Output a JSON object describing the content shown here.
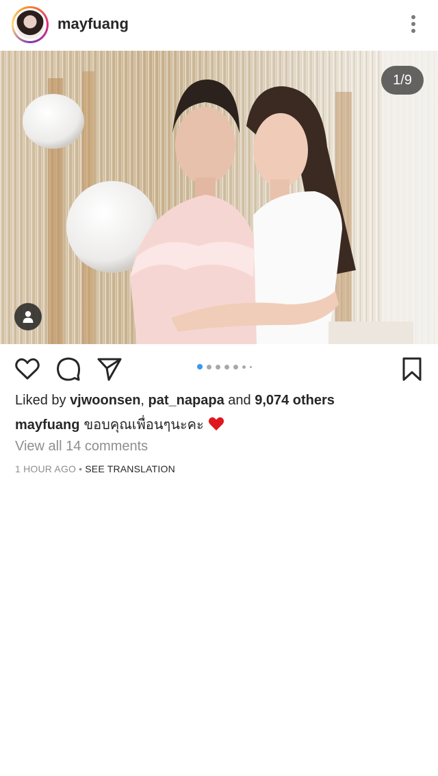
{
  "header": {
    "username": "mayfuang"
  },
  "photo": {
    "counter": "1/9",
    "icons": {
      "tag": "person-tag-icon"
    }
  },
  "actions": {
    "icons": [
      "heart-icon",
      "comment-icon",
      "share-icon",
      "bookmark-icon"
    ],
    "carousel_dots": 7,
    "carousel_active_index": 0
  },
  "likes": {
    "prefix": "Liked by",
    "user1": "vjwoonsen",
    "separator": ",",
    "user2": "pat_napapa",
    "conjunction": "and",
    "others": "9,074 others"
  },
  "caption": {
    "username": "mayfuang",
    "text": "ขอบคุณเพื่อนๆนะคะ",
    "emoji": "red-heart-emoji"
  },
  "comments": {
    "view_all": "View all 14 comments"
  },
  "meta": {
    "time": "1 HOUR AGO",
    "separator": "•",
    "translate": "SEE TRANSLATION"
  },
  "colors": {
    "text": "#262626",
    "muted": "#8e8e8e",
    "accent_dot": "#3897f0",
    "heart": "#ed4956"
  }
}
